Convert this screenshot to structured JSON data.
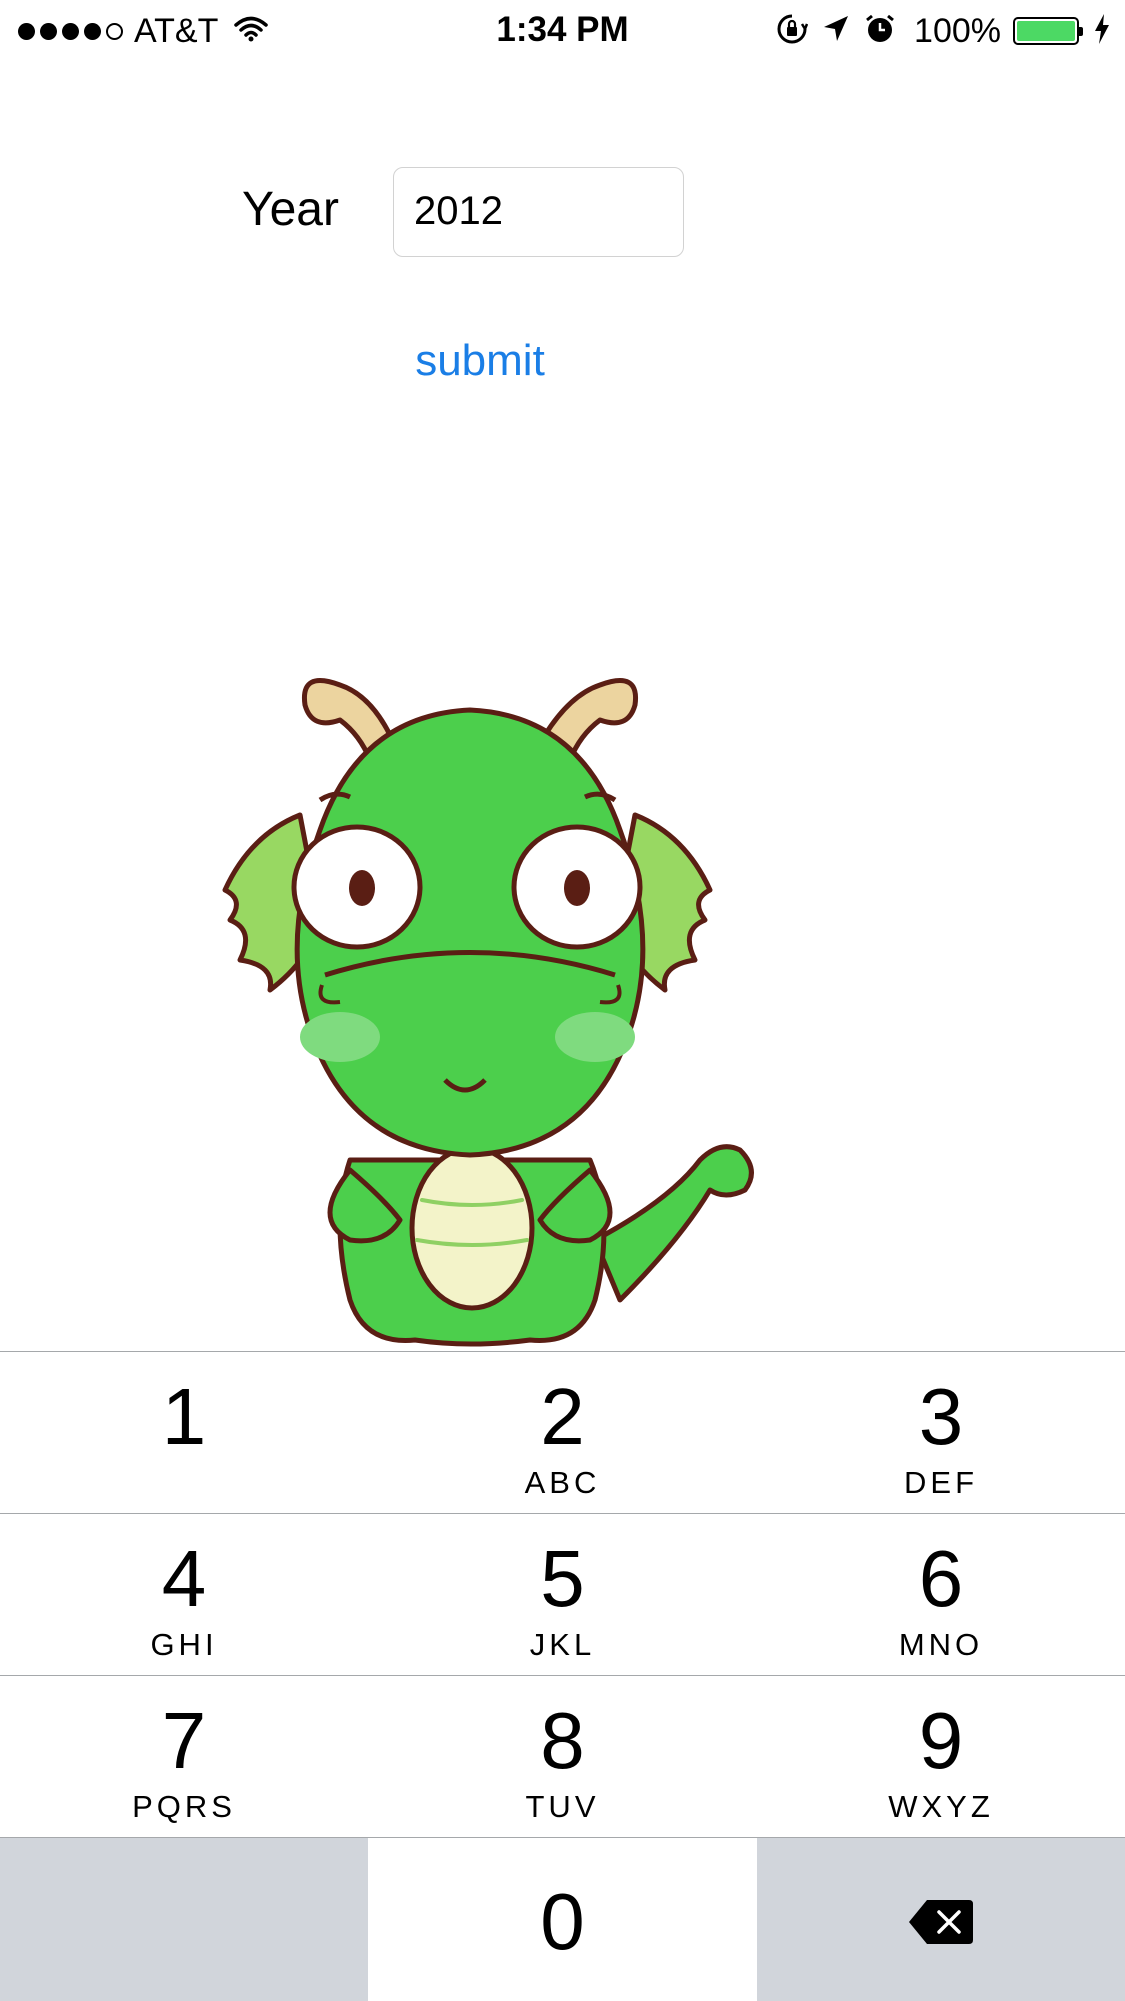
{
  "status_bar": {
    "carrier": "AT&T",
    "time": "1:34 PM",
    "battery_percent": "100%",
    "signal_bars_filled": 4,
    "signal_bars_total": 5,
    "battery_color": "#4cd964"
  },
  "form": {
    "year_label": "Year",
    "year_value": "2012",
    "submit_label": "submit",
    "accent_color": "#1a7ee6"
  },
  "image": {
    "description_icon": "green-dragon-cartoon"
  },
  "keypad": {
    "keys": [
      {
        "num": "1",
        "letters": ""
      },
      {
        "num": "2",
        "letters": "ABC"
      },
      {
        "num": "3",
        "letters": "DEF"
      },
      {
        "num": "4",
        "letters": "GHI"
      },
      {
        "num": "5",
        "letters": "JKL"
      },
      {
        "num": "6",
        "letters": "MNO"
      },
      {
        "num": "7",
        "letters": "PQRS"
      },
      {
        "num": "8",
        "letters": "TUV"
      },
      {
        "num": "9",
        "letters": "WXYZ"
      },
      {
        "num": "0",
        "letters": ""
      }
    ],
    "delete_icon": "backspace-icon"
  }
}
